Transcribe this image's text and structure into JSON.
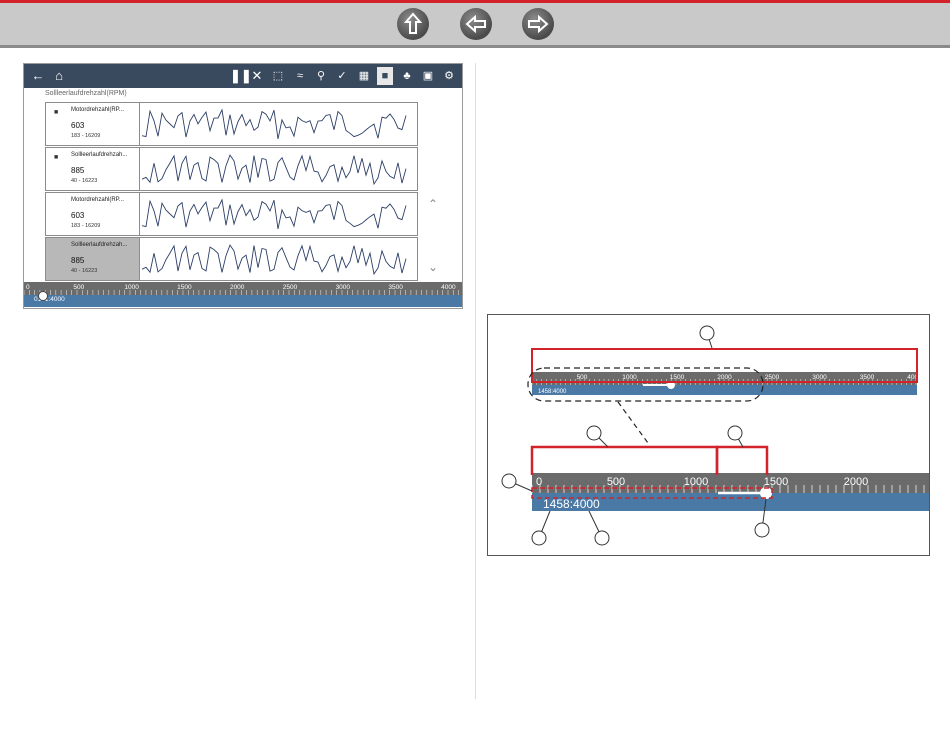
{
  "nav": {
    "buttons": [
      {
        "name": "home-up-button",
        "icon": "up-arrow-icon"
      },
      {
        "name": "back-button",
        "icon": "left-arrow-icon"
      },
      {
        "name": "forward-button",
        "icon": "right-arrow-icon"
      }
    ]
  },
  "screenshot": {
    "subtitle": "Sollleerlaufdrehzahl(RPM)",
    "toolbar_icons": [
      "back-arrow-icon",
      "home-icon",
      "pause-icon",
      "close-icon",
      "zoom-fit-icon",
      "graph-icon",
      "magnify-icon",
      "checklist-icon",
      "filter-icon",
      "lock-icon",
      "bell-icon",
      "save-icon",
      "gear-icon"
    ],
    "rows": [
      {
        "name": "Motordrehzahl(RP...",
        "value": "603",
        "range": "183 - 16209",
        "locked": true,
        "selected": false
      },
      {
        "name": "Sollleerlaufdrehzah...",
        "value": "885",
        "range": "40 - 16223",
        "locked": true,
        "selected": false
      },
      {
        "name": "Motordrehzahl(RP...",
        "value": "603",
        "range": "183 - 16209",
        "locked": false,
        "selected": false
      },
      {
        "name": "Sollleerlaufdrehzah...",
        "value": "885",
        "range": "40 - 16223",
        "locked": false,
        "selected": true
      }
    ],
    "scale_ticks": [
      "0",
      "500",
      "1000",
      "1500",
      "2000",
      "2500",
      "3000",
      "3500",
      "4000"
    ],
    "position_readout": "0171:4000"
  },
  "diagram": {
    "small_scale_ticks": [
      "500",
      "1000",
      "1500",
      "2000",
      "2500",
      "3000",
      "3500",
      "4000"
    ],
    "small_readout": "1458:4000",
    "large_scale_ticks": [
      "0",
      "500",
      "1000",
      "1500",
      "2000",
      "2"
    ],
    "large_readout": "1458:4000"
  },
  "colors": {
    "accent_red": "#d2232a",
    "toolbar_bg": "#3a4a5e",
    "scale_blue": "#4a79a5",
    "trace": "#2c3e66"
  }
}
